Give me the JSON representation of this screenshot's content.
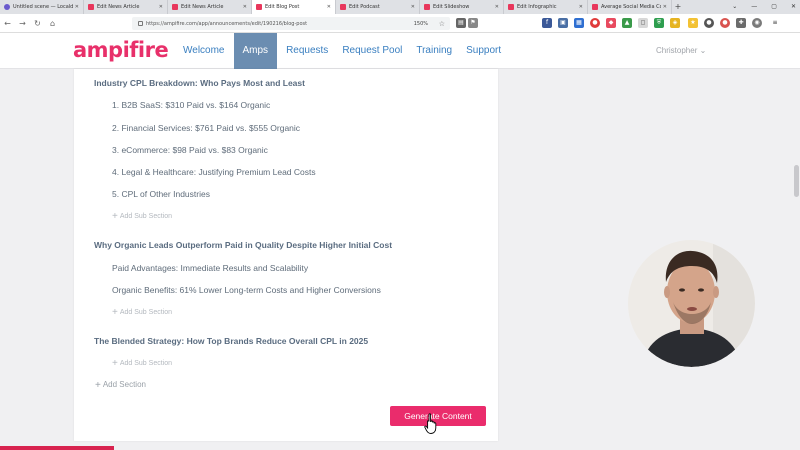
{
  "browser": {
    "tabs": [
      {
        "title": "Untitled scene — Localdrive",
        "active": false
      },
      {
        "title": "Edit News Article",
        "active": false
      },
      {
        "title": "Edit News Article",
        "active": false
      },
      {
        "title": "Edit Blog Post",
        "active": true
      },
      {
        "title": "Edit Podcast",
        "active": false
      },
      {
        "title": "Edit Slideshow",
        "active": false
      },
      {
        "title": "Edit Infographic",
        "active": false
      },
      {
        "title": "Average Social Media Cost",
        "active": false
      }
    ],
    "url": "https://ampifire.com/app/announcements/edit/190216/blog-post",
    "zoom": "150%"
  },
  "app": {
    "logo": "ampifire",
    "brand_color": "#e8306a",
    "nav": [
      {
        "label": "Welcome",
        "active": false
      },
      {
        "label": "Amps",
        "active": true
      },
      {
        "label": "Requests",
        "active": false
      },
      {
        "label": "Request Pool",
        "active": false
      },
      {
        "label": "Training",
        "active": false
      },
      {
        "label": "Support",
        "active": false
      }
    ],
    "user_name": "Christopher"
  },
  "outline": {
    "sections": [
      {
        "title": "Industry CPL Breakdown: Who Pays Most and Least",
        "subsections": [
          "1. B2B SaaS: $310 Paid vs. $164 Organic",
          "2. Financial Services: $761 Paid vs. $555 Organic",
          "3. eCommerce: $98 Paid vs. $83 Organic",
          "4. Legal & Healthcare: Justifying Premium Lead Costs",
          "5. CPL of Other Industries"
        ]
      },
      {
        "title": "Why Organic Leads Outperform Paid in Quality Despite Higher Initial Cost",
        "subsections": [
          "Paid Advantages: Immediate Results and Scalability",
          "Organic Benefits: 61% Lower Long-term Costs and Higher Conversions"
        ]
      },
      {
        "title": "The Blended Strategy: How Top Brands Reduce Overall CPL in 2025",
        "subsections": []
      }
    ],
    "add_sub_section_label": "Add Sub Section",
    "add_section_label": "Add Section",
    "generate_button_label": "Generate Content"
  }
}
